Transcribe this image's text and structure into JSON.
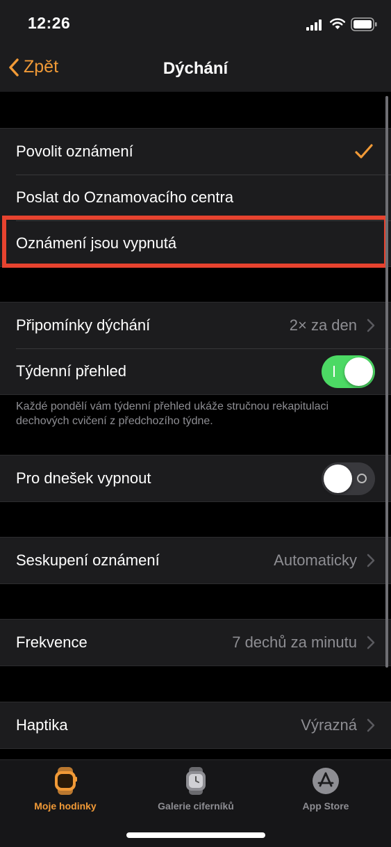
{
  "status": {
    "time": "12:26"
  },
  "nav": {
    "back_label": "Zpět",
    "title": "Dýchání"
  },
  "group1": {
    "items": [
      {
        "label": "Povolit oznámení",
        "checked": true
      },
      {
        "label": "Poslat do Oznamovacího centra"
      },
      {
        "label": "Oznámení jsou vypnutá"
      }
    ]
  },
  "group2": {
    "reminders": {
      "label": "Připomínky dýchání",
      "value": "2× za den"
    },
    "weekly": {
      "label": "Týdenní přehled",
      "toggle": true
    },
    "footnote": "Každé pondělí vám týdenní přehled ukáže stručnou rekapitulaci dechových cvičení z předchozího týdne."
  },
  "group3": {
    "label": "Pro dnešek vypnout",
    "toggle": false
  },
  "group4": {
    "label": "Seskupení oznámení",
    "value": "Automaticky"
  },
  "group5": {
    "label": "Frekvence",
    "value": "7 dechů za minutu"
  },
  "group6": {
    "label": "Haptika",
    "value": "Výrazná"
  },
  "tabs": [
    {
      "label": "Moje hodinky",
      "icon": "watch-icon",
      "active": true
    },
    {
      "label": "Galerie ciferníků",
      "icon": "watch-face-icon",
      "active": false
    },
    {
      "label": "App Store",
      "icon": "app-store-icon",
      "active": false
    }
  ],
  "colors": {
    "accent": "#f19a37",
    "toggle_on": "#4cd964",
    "highlight": "#e7432f"
  }
}
